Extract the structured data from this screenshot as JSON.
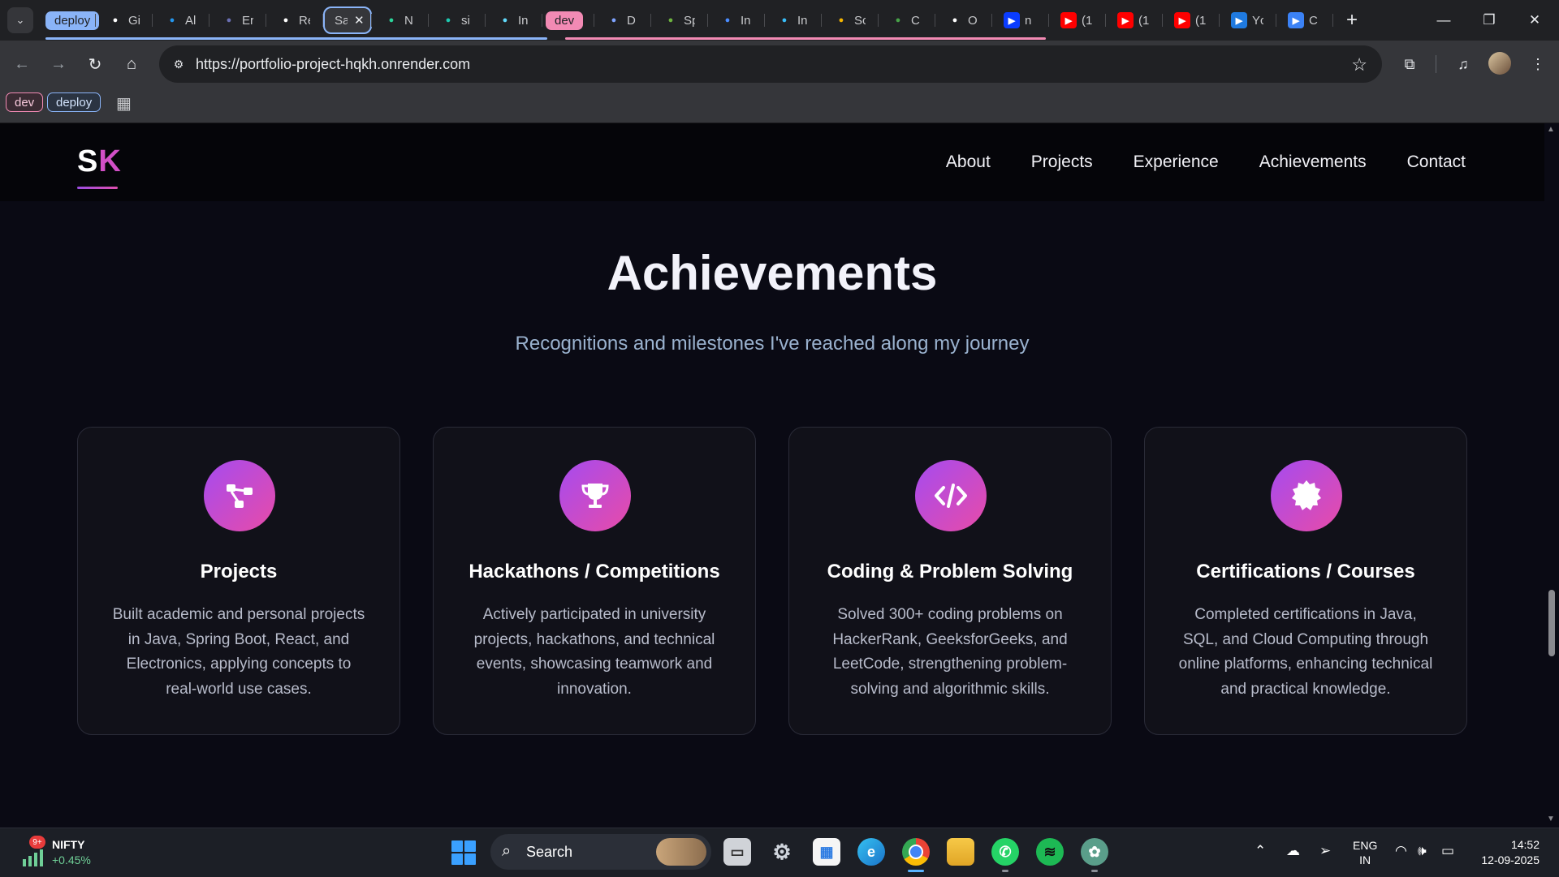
{
  "browser": {
    "tab_group_left": "deploy",
    "tab_group_right": "dev",
    "tabs": [
      {
        "icon": "github-icon",
        "label": "Gi",
        "color": "#ffffff",
        "bg": "transparent"
      },
      {
        "icon": "docker-icon",
        "label": "Al",
        "color": "#2496ed",
        "bg": "transparent"
      },
      {
        "icon": "eclipse-icon",
        "label": "Er",
        "color": "#6a6fb3",
        "bg": "transparent"
      },
      {
        "icon": "render-icon",
        "label": "Re",
        "color": "#ffffff",
        "bg": "transparent"
      }
    ],
    "active_tab": {
      "label": "Sa",
      "close": "✕"
    },
    "tabs_after": [
      {
        "icon": "notion-n-icon",
        "label": "N",
        "color": "#2bd49a",
        "bg": "transparent"
      },
      {
        "icon": "diamond-icon",
        "label": "si",
        "color": "#1ec8b0",
        "bg": "transparent"
      },
      {
        "icon": "react-icon",
        "label": "In",
        "color": "#61dafb",
        "bg": "transparent"
      }
    ],
    "tabs_dev": [
      {
        "icon": "gear-icon",
        "label": "D",
        "color": "#7ea3ff",
        "bg": "transparent"
      },
      {
        "icon": "spring-icon",
        "label": "Sp",
        "color": "#6db33f",
        "bg": "transparent"
      },
      {
        "icon": "mui-icon",
        "label": "In",
        "color": "#4a8cff",
        "bg": "transparent"
      },
      {
        "icon": "tailwind-icon",
        "label": "In",
        "color": "#38bdf8",
        "bg": "transparent"
      },
      {
        "icon": "multi-color-icon",
        "label": "Sc",
        "color": "#f4b400",
        "bg": "transparent"
      },
      {
        "icon": "mongodb-icon",
        "label": "C",
        "color": "#47a248",
        "bg": "transparent"
      },
      {
        "icon": "chatgpt-c-icon",
        "label": "O",
        "color": "#ffffff",
        "bg": "transparent"
      }
    ],
    "tabs_tail": [
      {
        "icon": "n-icon",
        "label": "n",
        "color": "#ffffff",
        "bg": "#0a3cff"
      },
      {
        "icon": "youtube-icon",
        "label": "(1",
        "color": "#ffffff",
        "bg": "#ff0000"
      },
      {
        "icon": "youtube-icon",
        "label": "(1",
        "color": "#ffffff",
        "bg": "#ff0000"
      },
      {
        "icon": "youtube-icon",
        "label": "(1",
        "color": "#ffffff",
        "bg": "#ff0000"
      },
      {
        "icon": "s-icon",
        "label": "Yc",
        "color": "#ffffff",
        "bg": "#1f7ae0"
      },
      {
        "icon": "c-circle-icon",
        "label": "C",
        "color": "#ffffff",
        "bg": "#3b82f6"
      }
    ],
    "url": "https://portfolio-project-hqkh.onrender.com",
    "bookmarks": [
      "dev",
      "deploy"
    ]
  },
  "site": {
    "logo_s": "S",
    "logo_k": "K",
    "nav": [
      "About",
      "Projects",
      "Experience",
      "Achievements",
      "Contact"
    ],
    "section_title": "Achievements",
    "section_subtitle": "Recognitions and milestones I've reached along my journey",
    "cards": [
      {
        "icon": "project-graph-icon",
        "title": "Projects",
        "body": "Built academic and personal projects in Java, Spring Boot, React, and Electronics, applying concepts to real-world use cases."
      },
      {
        "icon": "trophy-icon",
        "title": "Hackathons / Competitions",
        "body": "Actively participated in university projects, hackathons, and technical events, showcasing teamwork and innovation."
      },
      {
        "icon": "code-icon",
        "title": "Coding & Problem Solving",
        "body": "Solved 300+ coding problems on HackerRank, GeeksforGeeks, and LeetCode, strengthening problem-solving and algorithmic skills."
      },
      {
        "icon": "certificate-badge-icon",
        "title": "Certifications / Courses",
        "body": "Completed certifications in Java, SQL, and Cloud Computing through online platforms, enhancing technical and practical knowledge."
      }
    ],
    "accent_from": "#a54bf0",
    "accent_to": "#e84ba8"
  },
  "taskbar": {
    "widget_badge": "9+",
    "widget_name": "NIFTY",
    "widget_value": "+0.45%",
    "search_label": "Search",
    "lang_line1": "ENG",
    "lang_line2": "IN",
    "time": "14:52",
    "date": "12-09-2025"
  }
}
